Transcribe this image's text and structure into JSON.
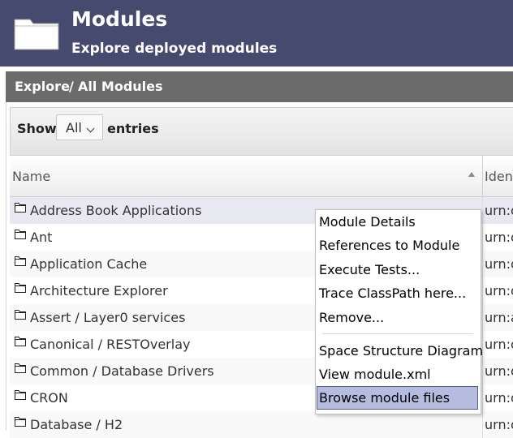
{
  "header": {
    "title": "Modules",
    "subtitle": "Explore deployed modules",
    "icon": "folder-icon",
    "background": "#474a6f"
  },
  "breadcrumb": {
    "items": [
      "Explore",
      "All Modules"
    ],
    "separator": "/"
  },
  "toolbar": {
    "show_label": "Show",
    "page_size": "All",
    "entries_label": "entries"
  },
  "table": {
    "columns": [
      "Name",
      "Iden"
    ],
    "rows": [
      {
        "name": "Address Book Applications",
        "identifier": "urn:o"
      },
      {
        "name": "Ant",
        "identifier": "urn:o"
      },
      {
        "name": "Application Cache",
        "identifier": "urn:o"
      },
      {
        "name": "Architecture Explorer",
        "identifier": "urn:o"
      },
      {
        "name": "Assert / Layer0 services",
        "identifier": "urn:a"
      },
      {
        "name": "Canonical / RESTOverlay",
        "identifier": "urn:o"
      },
      {
        "name": "Common / Database Drivers",
        "identifier": "urn:o"
      },
      {
        "name": "CRON",
        "identifier": "urn:o"
      },
      {
        "name": "Database / H2",
        "identifier": "urn:o"
      }
    ]
  },
  "context_menu": {
    "items": [
      "Module Details",
      "References to Module",
      "Execute Tests...",
      "Trace ClassPath here...",
      "Remove...",
      "Space Structure Diagram",
      "View module.xml",
      "Browse module files"
    ],
    "highlighted": "Browse module files",
    "highlight_color": "#b6bce0"
  }
}
